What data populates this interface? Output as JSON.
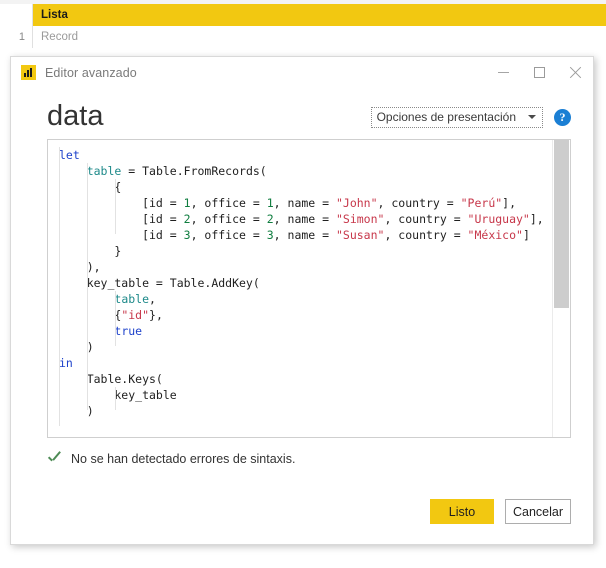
{
  "background_grid": {
    "row_number": "1",
    "column_header": "Lista",
    "cell_value": "Record",
    "header_color": "#f2c811"
  },
  "dialog": {
    "titlebar": {
      "app_icon": "power-bi-icon",
      "title": "Editor avanzado",
      "minimize_label": "—",
      "maximize_label": "☐",
      "close_label": "✕"
    },
    "header": {
      "query_name": "data",
      "display_options_label": "Opciones de presentación",
      "help_label": "?"
    },
    "editor": {
      "lines": [
        [
          {
            "t": "let",
            "c": "kw"
          }
        ],
        [
          {
            "t": "    ",
            "c": "plain"
          },
          {
            "t": "table",
            "c": "ident"
          },
          {
            "t": " = Table.FromRecords(",
            "c": "plain"
          }
        ],
        [
          {
            "t": "        {",
            "c": "plain"
          }
        ],
        [
          {
            "t": "            [id = ",
            "c": "plain"
          },
          {
            "t": "1",
            "c": "num"
          },
          {
            "t": ", office = ",
            "c": "plain"
          },
          {
            "t": "1",
            "c": "num"
          },
          {
            "t": ", name = ",
            "c": "plain"
          },
          {
            "t": "\"John\"",
            "c": "str"
          },
          {
            "t": ", country = ",
            "c": "plain"
          },
          {
            "t": "\"Perú\"",
            "c": "str"
          },
          {
            "t": "],",
            "c": "plain"
          }
        ],
        [
          {
            "t": "            [id = ",
            "c": "plain"
          },
          {
            "t": "2",
            "c": "num"
          },
          {
            "t": ", office = ",
            "c": "plain"
          },
          {
            "t": "2",
            "c": "num"
          },
          {
            "t": ", name = ",
            "c": "plain"
          },
          {
            "t": "\"Simon\"",
            "c": "str"
          },
          {
            "t": ", country = ",
            "c": "plain"
          },
          {
            "t": "\"Uruguay\"",
            "c": "str"
          },
          {
            "t": "],",
            "c": "plain"
          }
        ],
        [
          {
            "t": "            [id = ",
            "c": "plain"
          },
          {
            "t": "3",
            "c": "num"
          },
          {
            "t": ", office = ",
            "c": "plain"
          },
          {
            "t": "3",
            "c": "num"
          },
          {
            "t": ", name = ",
            "c": "plain"
          },
          {
            "t": "\"Susan\"",
            "c": "str"
          },
          {
            "t": ", country = ",
            "c": "plain"
          },
          {
            "t": "\"México\"",
            "c": "str"
          },
          {
            "t": "]",
            "c": "plain"
          }
        ],
        [
          {
            "t": "        }",
            "c": "plain"
          }
        ],
        [
          {
            "t": "    ),",
            "c": "plain"
          }
        ],
        [
          {
            "t": "    key_table = Table.AddKey(",
            "c": "plain"
          }
        ],
        [
          {
            "t": "        ",
            "c": "plain"
          },
          {
            "t": "table",
            "c": "ident"
          },
          {
            "t": ",",
            "c": "plain"
          }
        ],
        [
          {
            "t": "        {",
            "c": "plain"
          },
          {
            "t": "\"id\"",
            "c": "str"
          },
          {
            "t": "},",
            "c": "plain"
          }
        ],
        [
          {
            "t": "        ",
            "c": "plain"
          },
          {
            "t": "true",
            "c": "kw"
          }
        ],
        [
          {
            "t": "    )",
            "c": "plain"
          }
        ],
        [
          {
            "t": "in",
            "c": "kw"
          }
        ],
        [
          {
            "t": "    Table.Keys(",
            "c": "plain"
          }
        ],
        [
          {
            "t": "        key_table",
            "c": "plain"
          }
        ],
        [
          {
            "t": "    )",
            "c": "plain"
          }
        ]
      ],
      "scrollbar": {
        "thumb_label": "vertical-scroll-thumb"
      }
    },
    "status": {
      "icon": "check-icon",
      "message": "No se han detectado errores de sintaxis."
    },
    "footer": {
      "primary_label": "Listo",
      "secondary_label": "Cancelar",
      "primary_color": "#f2c811"
    }
  }
}
